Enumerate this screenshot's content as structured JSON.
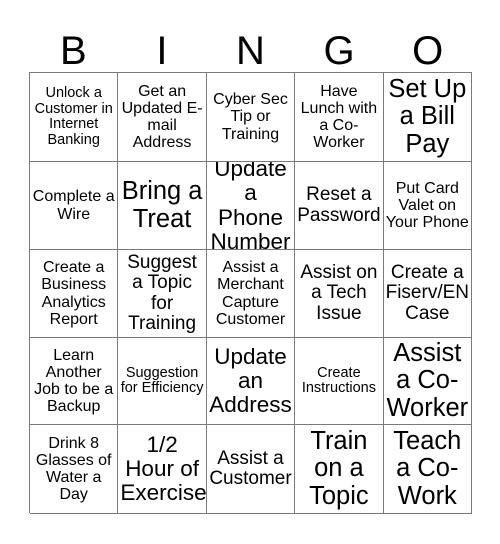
{
  "card": {
    "header_letters": [
      "B",
      "I",
      "N",
      "G",
      "O"
    ],
    "columns": 5,
    "rows": 5,
    "border_color": "#7a7a7a",
    "text_color": "#000000",
    "background_color": "#ffffff"
  },
  "cells": [
    {
      "text": "Unlock a Customer in Internet Banking",
      "size": "sm"
    },
    {
      "text": "Get an Updated E-mail Address",
      "size": "md"
    },
    {
      "text": "Cyber Sec Tip or Training",
      "size": "md"
    },
    {
      "text": "Have Lunch with a Co-Worker",
      "size": "md"
    },
    {
      "text": "Set Up a Bill Pay",
      "size": "xxl"
    },
    {
      "text": "Complete a Wire",
      "size": "md"
    },
    {
      "text": "Bring a Treat",
      "size": "xxl"
    },
    {
      "text": "Update a Phone Number",
      "size": "xl"
    },
    {
      "text": "Reset a Password",
      "size": "lg"
    },
    {
      "text": "Put Card Valet on Your Phone",
      "size": "md"
    },
    {
      "text": "Create a Business Analytics Report",
      "size": "md"
    },
    {
      "text": "Suggest a Topic for Training",
      "size": "lg"
    },
    {
      "text": "Assist a Merchant Capture Customer",
      "size": "md"
    },
    {
      "text": "Assist on a Tech Issue",
      "size": "lg"
    },
    {
      "text": "Create a Fiserv/EN Case",
      "size": "lg"
    },
    {
      "text": "Learn Another Job to be a Backup",
      "size": "md"
    },
    {
      "text": "Suggestion for Efficiency",
      "size": "sm"
    },
    {
      "text": "Update an Address",
      "size": "xl"
    },
    {
      "text": "Create Instructions",
      "size": "sm"
    },
    {
      "text": "Assist a Co-Worker",
      "size": "xxl"
    },
    {
      "text": "Drink 8 Glasses of Water a Day",
      "size": "md"
    },
    {
      "text": "1/2 Hour of Exercise",
      "size": "xl"
    },
    {
      "text": "Assist a Customer",
      "size": "lg"
    },
    {
      "text": "Train on a Topic",
      "size": "xxl"
    },
    {
      "text": "Teach a Co-Work",
      "size": "xxl"
    }
  ]
}
